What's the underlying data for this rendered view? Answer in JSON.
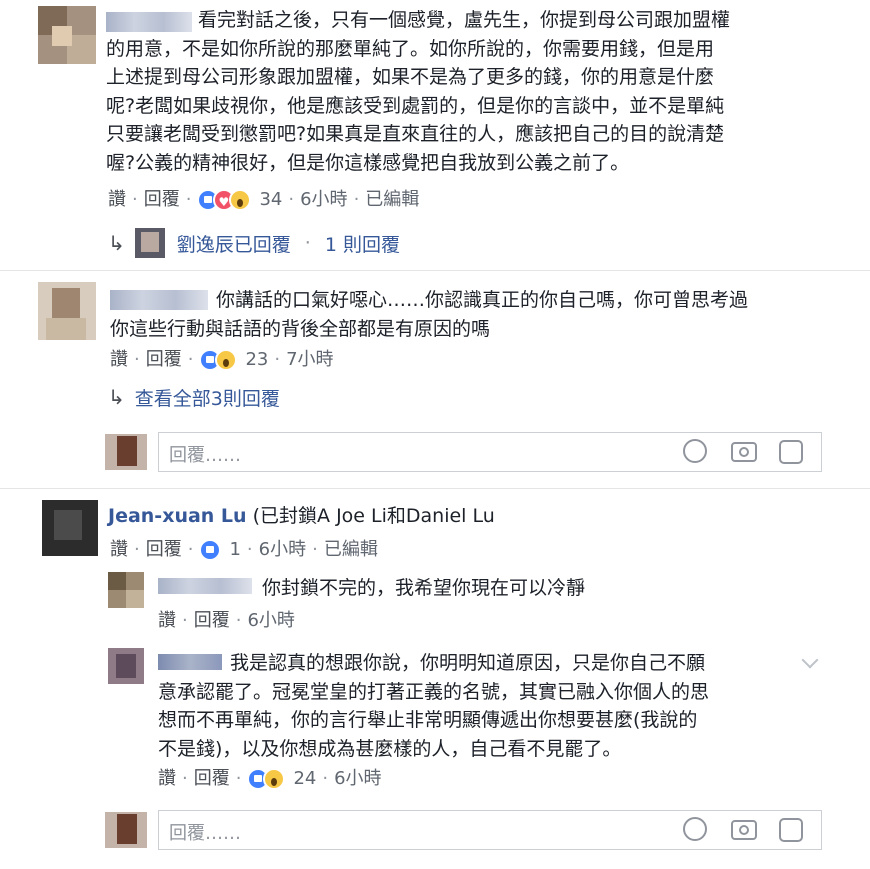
{
  "comments": [
    {
      "text_lines": [
        "看完對話之後，只有一個感覺，盧先生，你提到母公司跟加盟權",
        "的用意，不是如你所說的那麼單純了。如你所說的，你需要用錢，但是用",
        "上述提到母公司形象跟加盟權，如果不是為了更多的錢，你的用意是什麼",
        "呢?老闆如果歧視你，他是應該受到處罰的，但是你的言談中，並不是單純",
        "只要讓老闆受到懲罰吧?如果真是直來直往的人，應該把自己的目的說清楚",
        "喔?公義的精神很好，但是你這樣感覺把自我放到公義之前了。"
      ],
      "like": "讚",
      "reply": "回覆",
      "reaction_count": "34",
      "time": "6小時",
      "edited": "已編輯",
      "replies_summary": {
        "name": "劉逸辰已回覆",
        "count": "1 則回覆"
      }
    },
    {
      "text_lines": [
        "你講話的口氣好噁心……你認識真正的你自己嗎，你可曾思考過",
        "你這些行動與話語的背後全部都是有原因的嗎"
      ],
      "like": "讚",
      "reply": "回覆",
      "reaction_count": "23",
      "time": "7小時",
      "view_all_replies": "查看全部3則回覆"
    },
    {
      "author": "Jean-xuan Lu",
      "text": "(已封鎖A Joe Li和Daniel Lu",
      "like": "讚",
      "reply": "回覆",
      "reaction_count": "1",
      "time": "6小時",
      "edited": "已編輯",
      "replies": [
        {
          "text_lines": [
            "你封鎖不完的，我希望你現在可以冷靜"
          ],
          "like": "讚",
          "reply": "回覆",
          "time": "6小時"
        },
        {
          "text_lines": [
            "我是認真的想跟你說，你明明知道原因，只是你自己不願",
            "意承認罷了。冠冕堂皇的打著正義的名號，其實已融入你個人的思",
            "想而不再單純，你的言行舉止非常明顯傳遞出你想要甚麼(我說的",
            "不是錢)，以及你想成為甚麼樣的人，自己看不見罷了。"
          ],
          "like": "讚",
          "reply": "回覆",
          "reaction_count": "24",
          "time": "6小時"
        }
      ]
    }
  ],
  "reply_box": {
    "placeholder": "回覆……"
  },
  "sep": "·",
  "icons": {
    "emoji": "smiley-icon",
    "camera": "camera-icon",
    "sticker": "sticker-icon",
    "reply_arrow": "reply-arrow-icon"
  },
  "colors": {
    "link": "#365899",
    "meta": "#606770",
    "like_blue": "#4080ff"
  }
}
